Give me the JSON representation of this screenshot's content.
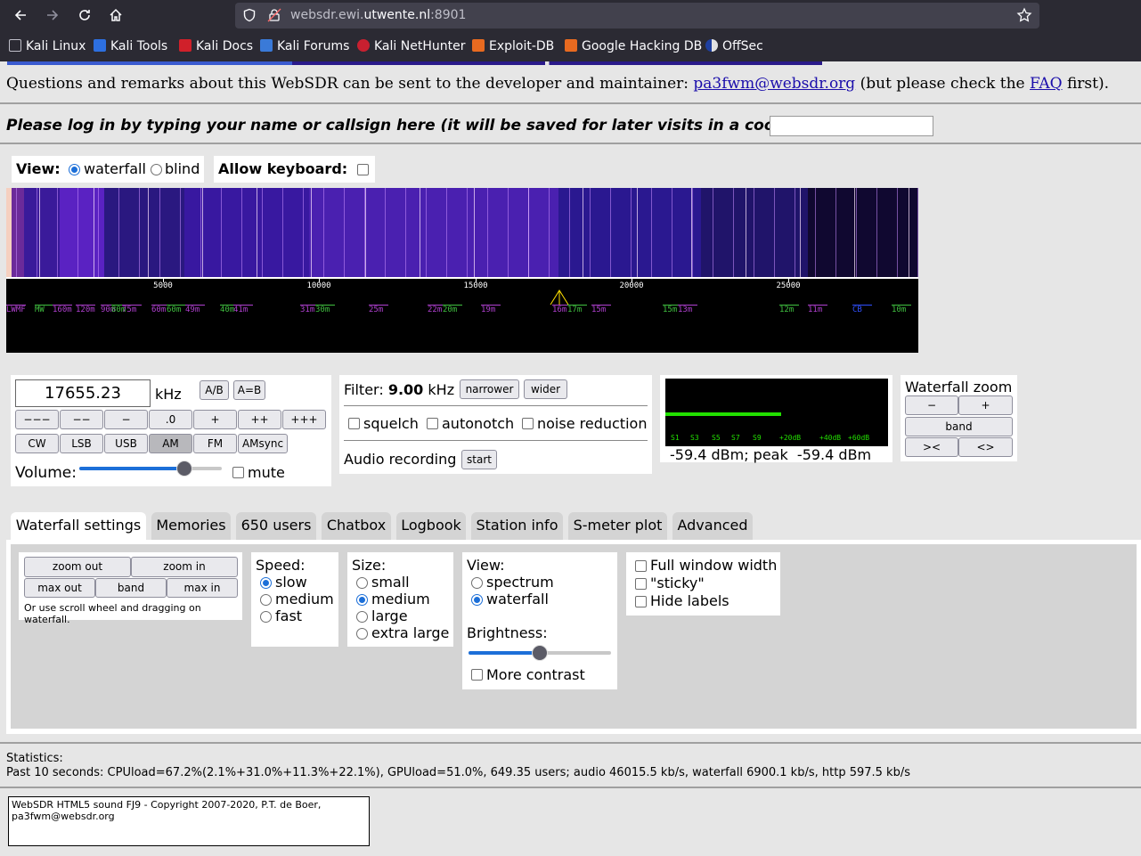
{
  "browser": {
    "url_prefix": "websdr.ewi.",
    "url_domain": "utwente.nl",
    "url_suffix": ":8901",
    "bookmarks": [
      "Kali Linux",
      "Kali Tools",
      "Kali Docs",
      "Kali Forums",
      "Kali NetHunter",
      "Exploit-DB",
      "Google Hacking DB",
      "OffSec"
    ]
  },
  "page": {
    "remarks_pre": "Questions and remarks about this WebSDR can be sent to the developer and maintainer: ",
    "remarks_email": "pa3fwm@websdr.org",
    "remarks_mid": " (but please check the ",
    "remarks_faq": "FAQ",
    "remarks_post": " first).",
    "login_prompt": "Please log in by typing your name or callsign here (it will be saved for later visits in a cookie):",
    "view_label": "View:",
    "view_waterfall": "waterfall",
    "view_blind": "blind",
    "allow_keyboard": "Allow keyboard:"
  },
  "waterfall": {
    "ticks": [
      "5000",
      "10000",
      "15000",
      "20000",
      "25000"
    ],
    "bands": [
      {
        "label": "LWMF",
        "color": "#b040d0"
      },
      {
        "label": "MW",
        "color": "#40c040"
      },
      {
        "label": "160m",
        "color": "#b040d0"
      },
      {
        "label": "120m",
        "color": "#b040d0"
      },
      {
        "label": "90m",
        "color": "#b040d0"
      },
      {
        "label": "80m",
        "color": "#40c040"
      },
      {
        "label": "75m",
        "color": "#b040d0"
      },
      {
        "label": "60m",
        "color": "#b040d0"
      },
      {
        "label": "60m",
        "color": "#40c040"
      },
      {
        "label": "49m",
        "color": "#b040d0"
      },
      {
        "label": "40m",
        "color": "#40c040"
      },
      {
        "label": "41m",
        "color": "#b040d0"
      },
      {
        "label": "31m",
        "color": "#b040d0"
      },
      {
        "label": "30m",
        "color": "#40c040"
      },
      {
        "label": "25m",
        "color": "#b040d0"
      },
      {
        "label": "22m",
        "color": "#b040d0"
      },
      {
        "label": "20m",
        "color": "#40c040"
      },
      {
        "label": "19m",
        "color": "#b040d0"
      },
      {
        "label": "16m",
        "color": "#b040d0"
      },
      {
        "label": "17m",
        "color": "#40c040"
      },
      {
        "label": "15m",
        "color": "#b040d0"
      },
      {
        "label": "15m",
        "color": "#40c040"
      },
      {
        "label": "13m",
        "color": "#b040d0"
      },
      {
        "label": "12m",
        "color": "#40c040"
      },
      {
        "label": "11m",
        "color": "#b040d0"
      },
      {
        "label": "CB",
        "color": "#3050ff"
      },
      {
        "label": "10m",
        "color": "#40c040"
      }
    ]
  },
  "tuner": {
    "frequency": "17655.23",
    "unit": "kHz",
    "ab": "A/B",
    "aeqb": "A=B",
    "steps": [
      "−−−",
      "−−",
      "−",
      ".0",
      "+",
      "++",
      "+++"
    ],
    "modes": [
      "CW",
      "LSB",
      "USB",
      "AM",
      "FM",
      "AMsync"
    ],
    "selected_mode": "AM",
    "volume_label": "Volume:",
    "volume_level": 0.74,
    "mute": "mute"
  },
  "filter": {
    "label": "Filter: ",
    "value": "9.00",
    "unit": " kHz",
    "narrower": "narrower",
    "wider": "wider",
    "squelch": "squelch",
    "autonotch": "autonotch",
    "noise_reduction": "noise reduction",
    "audio_recording": "Audio recording",
    "start": "start"
  },
  "smeter": {
    "scale": [
      "S1",
      "S3",
      "S5",
      "S7",
      "S9",
      "+20dB",
      "+40dB",
      "+60dB"
    ],
    "reading": "-59.4 dBm; peak  -59.4 dBm",
    "level": 0.54
  },
  "zoom": {
    "title": "Waterfall zoom",
    "minus": "−",
    "plus": "+",
    "band": "band",
    "in": "><",
    "out": "<>"
  },
  "tabs": [
    "Waterfall settings",
    "Memories",
    "650 users",
    "Chatbox",
    "Logbook",
    "Station info",
    "S-meter plot",
    "Advanced"
  ],
  "wf_settings": {
    "zoom_out": "zoom out",
    "zoom_in": "zoom in",
    "max_out": "max out",
    "band": "band",
    "max_in": "max in",
    "hint": "Or use scroll wheel and dragging on waterfall.",
    "speed_label": "Speed:",
    "speeds": [
      "slow",
      "medium",
      "fast"
    ],
    "size_label": "Size:",
    "sizes": [
      "small",
      "medium",
      "large",
      "extra large"
    ],
    "view_label": "View:",
    "views": [
      "spectrum",
      "waterfall"
    ],
    "brightness_label": "Brightness:",
    "brightness_level": 0.5,
    "more_contrast": "More contrast",
    "full_width": "Full window width",
    "sticky": "\"sticky\"",
    "hide_labels": "Hide labels"
  },
  "stats": {
    "label": "Statistics:",
    "line": "Past 10 seconds: CPUload=67.2%(2.1%+31.0%+11.3%+22.1%), GPUload=51.0%, 649.35 users; audio 46015.5 kb/s, waterfall 6900.1 kb/s, http 597.5 kb/s"
  },
  "footer": {
    "line1": "WebSDR HTML5 sound FJ9 - Copyright 2007-2020, P.T. de Boer,",
    "line2": "pa3fwm@websdr.org"
  }
}
